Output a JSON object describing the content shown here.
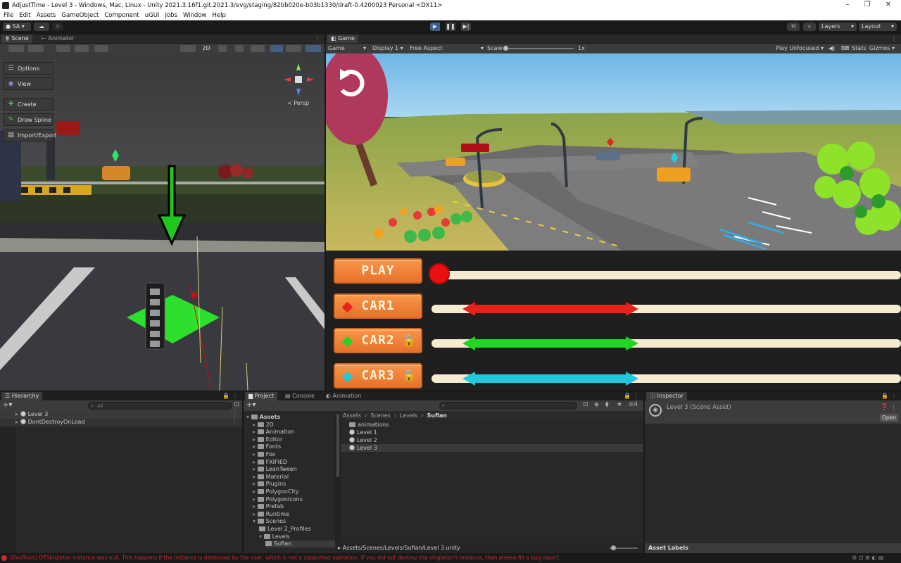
{
  "window": {
    "title": "AdjustTime - Level 3 - Windows, Mac, Linux - Unity 2021.3.16f1.git.2021.3/evg/staging/82bb020e-b03b1330/draft-0.4200023 Personal <DX11>",
    "controls": [
      "–",
      "❐",
      "✕"
    ]
  },
  "menu": [
    "File",
    "Edit",
    "Assets",
    "GameObject",
    "Component",
    "uGUI",
    "Jobs",
    "Window",
    "Help"
  ],
  "toolbar": {
    "account": "SA",
    "layers": "Layers",
    "layout": "Layout"
  },
  "scene_panel": {
    "tabs": [
      "Scene",
      "Animator"
    ],
    "mode_2d": "2D",
    "persp": "Persp",
    "overlay_buttons": [
      "Options",
      "View",
      "Create",
      "Draw Spline",
      "Import/Export"
    ]
  },
  "game_panel": {
    "tab": "Game",
    "display_mode": "Game",
    "display": "Display 1",
    "aspect": "Free Aspect",
    "scale_label": "Scale",
    "scale_value": "1x",
    "play_mode": "Play Unfocused",
    "stats": "Stats",
    "gizmos": "Gizmos",
    "ui": {
      "play_label": "PLAY",
      "cars": [
        {
          "label": "CAR1",
          "color": "#e8211b",
          "marker": "diamond",
          "locked": false
        },
        {
          "label": "CAR2",
          "color": "#22d622",
          "marker": "diamond",
          "locked": true
        },
        {
          "label": "CAR3",
          "color": "#22c8dc",
          "marker": "diamond",
          "locked": true
        }
      ]
    }
  },
  "hierarchy": {
    "tab": "Hierarchy",
    "search_placeholder": "All",
    "items": [
      "Level 3",
      "DontDestroyOnLoad"
    ]
  },
  "project": {
    "tabs": [
      "Project",
      "Console",
      "Animation"
    ],
    "count": "4",
    "tree": [
      "Assets",
      "2D",
      "Animation",
      "Editor",
      "Fonts",
      "Fox",
      "FXIFIED",
      "LeanTween",
      "Material",
      "Plugins",
      "PolygonCity",
      "PolygonIcons",
      "Prefab",
      "Runtime",
      "Scenes",
      "Level 2_Profiles",
      "Levels",
      "Sufian"
    ],
    "breadcrumb": [
      "Assets",
      "Scenes",
      "Levels",
      "Sufian"
    ],
    "files": [
      "animations",
      "Level 1",
      "Level 2",
      "Level 3"
    ],
    "selected_path": "Assets/Scenes/Levels/Sufian/Level 3.unity"
  },
  "inspector": {
    "tab": "Inspector",
    "title": "Level 3 (Scene Asset)",
    "open_label": "Open",
    "asset_labels": "Asset Labels"
  },
  "status": {
    "message": "[DevTools] DTSingleton instance was null. This happens if the instance is destroyed by the user, which is not a supported operation. If you did not destroy the singleton's instance, then please fill a bug report."
  }
}
